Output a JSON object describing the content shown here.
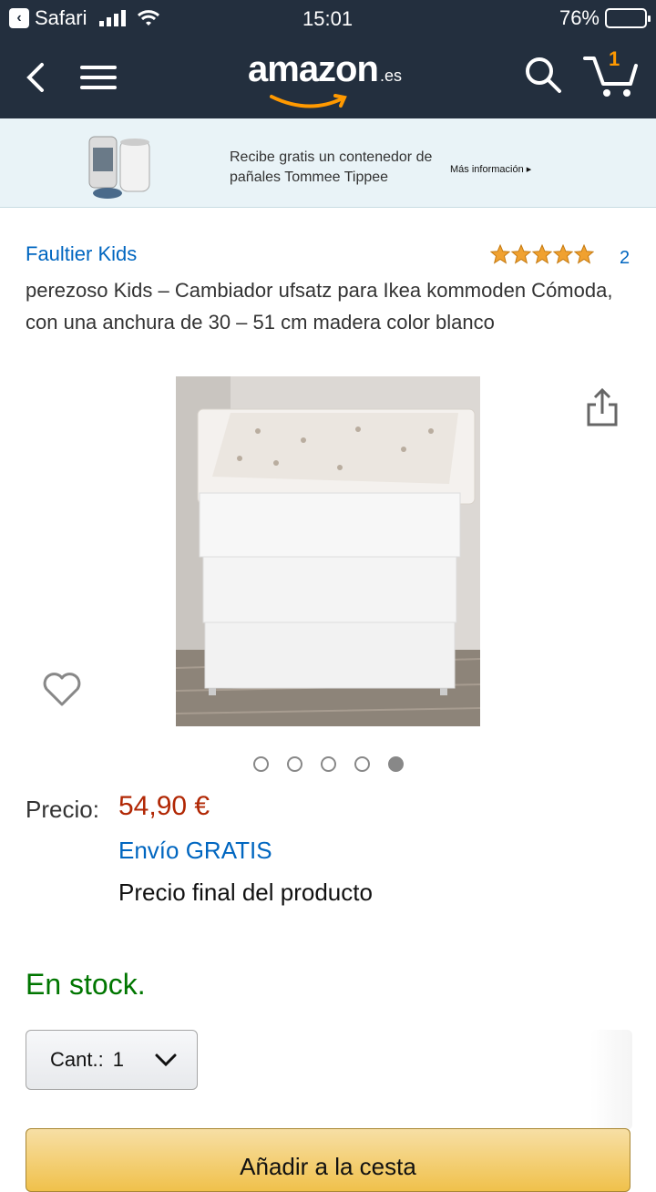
{
  "status_bar": {
    "back_app": "Safari",
    "time": "15:01",
    "battery": "76%",
    "battery_level": 0.76
  },
  "header": {
    "logo": "amazon",
    "logo_tld": ".es",
    "cart_count": "1"
  },
  "promo": {
    "text": "Recibe gratis un contenedor de pañales Tommee Tippee",
    "link": "Más información ▸"
  },
  "product": {
    "brand": "Faultier Kids",
    "rating_stars": 5,
    "rating_count": "2",
    "title": "perezoso Kids – Cambiador ufsatz para Ikea kommoden Cómoda, con una anchura de 30 – 51 cm madera color blanco",
    "image_count": 5,
    "active_image": 5,
    "price_label": "Precio:",
    "price": "54,90 €",
    "shipping": "Envío GRATIS",
    "final_price": "Precio final del producto",
    "stock": "En stock.",
    "quantity_label": "Cant.:",
    "quantity_value": "1",
    "add_to_cart": "Añadir a la cesta"
  },
  "colors": {
    "header_bg": "#232f3e",
    "link_blue": "#0066c0",
    "price_red": "#b12704",
    "stock_green": "#007600",
    "star_orange": "#f0a130",
    "button_yellow": "#f0c14b"
  }
}
